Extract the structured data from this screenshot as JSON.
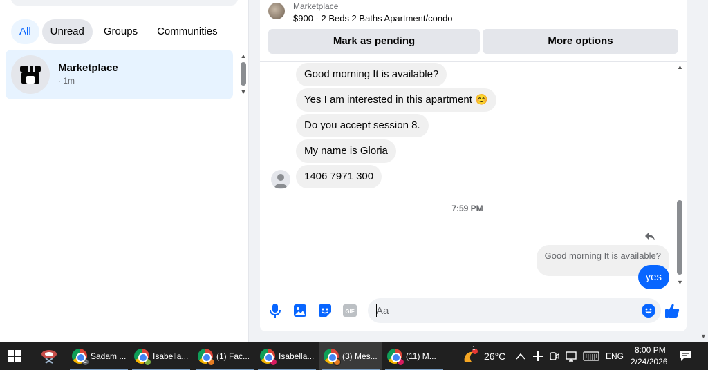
{
  "sidebar": {
    "filters": [
      "All",
      "Unread",
      "Groups",
      "Communities"
    ],
    "conversation": {
      "name": "Marketplace",
      "time": "· 1m"
    }
  },
  "listing": {
    "source": "Marketplace",
    "title": "$900 - 2 Beds 2 Baths Apartment/condo",
    "mark_pending": "Mark as pending",
    "more_options": "More options"
  },
  "messages": {
    "received": [
      "Good morning It is available?",
      "Yes I am interested in this apartment 😊",
      "Do you accept session 8.",
      "My name is Gloria",
      "1406 7971 300"
    ],
    "timestamp": "7:59 PM",
    "quoted_reply": "Good morning It is available?",
    "sent": "yes"
  },
  "composer": {
    "placeholder": "Aa",
    "icons": [
      "microphone-icon",
      "photo-icon",
      "sticker-icon",
      "gif-icon",
      "emoji-icon",
      "like-icon"
    ],
    "gif_label": "GIF"
  },
  "taskbar": {
    "apps": [
      {
        "label": "Sadam ...",
        "badge": "C",
        "profile_color": "#5f6368"
      },
      {
        "label": "Isabella...",
        "profile_color": "#7cb342"
      },
      {
        "label": "(1) Fac...",
        "profile_color": "#e67c22"
      },
      {
        "label": "Isabella...",
        "profile_color": "#d81b60"
      },
      {
        "label": "(3) Mes...",
        "profile_color": "#e67c22",
        "active": true
      },
      {
        "label": "(11) M...",
        "profile_color": "#d81b60"
      }
    ],
    "weather": {
      "temp": "26°C",
      "badge": "1"
    },
    "language": "ENG",
    "time": "8:00 PM",
    "date": "2/24/2026"
  },
  "colors": {
    "accent": "#0866ff",
    "taskbar": "#202020"
  }
}
